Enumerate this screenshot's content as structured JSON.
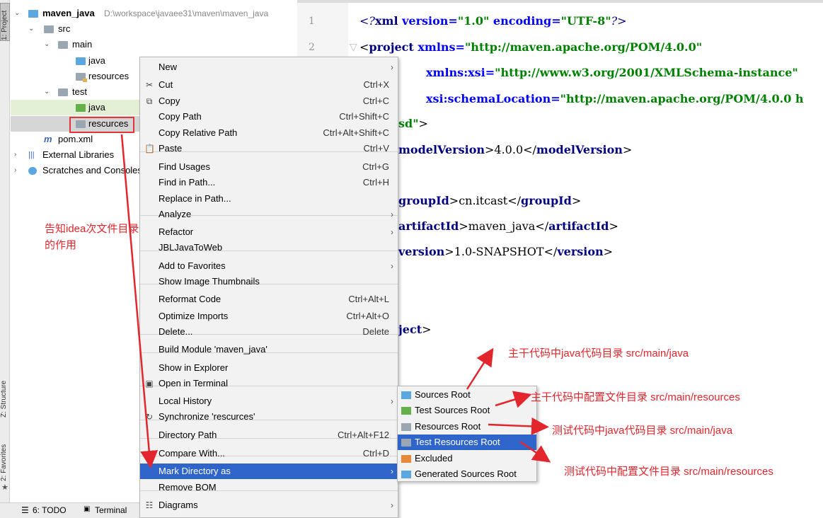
{
  "tool_strip": {
    "project_tab": "1: Project",
    "structure_tab": "Z: Structure",
    "favorites_tab": "2: Favorites"
  },
  "tree": {
    "root_name": "maven_java",
    "root_path": "D:\\workspace\\javaee31\\maven\\maven_java",
    "src": "src",
    "main": "main",
    "main_java": "java",
    "main_resources": "resources",
    "test": "test",
    "test_java": "java",
    "test_resources": "rescurces",
    "pom": "pom.xml",
    "external_libraries": "External Libraries",
    "scratches": "Scratches and Consoles"
  },
  "bottom_bar": {
    "todo": "6: TODO",
    "terminal": "Terminal"
  },
  "editor": {
    "line_numbers": [
      "1",
      "2"
    ],
    "lines": {
      "l1_decl_open": "<?",
      "l1_xml": "xml",
      "l1_version_attr": " version=",
      "l1_version_val": "\"1.0\"",
      "l1_encoding_attr": " encoding=",
      "l1_encoding_val": "\"UTF-8\"",
      "l1_decl_close": "?>",
      "l2_open": "<",
      "l2_tag": "project",
      "l2_attr": " xmlns=",
      "l2_val": "\"http://maven.apache.org/POM/4.0.0\"",
      "l3_attr": "xmlns:xsi=",
      "l3_val": "\"http://www.w3.org/2001/XMLSchema-instance\"",
      "l4_attr": "xsi:schemaLocation=",
      "l4_val": "\"http://maven.apache.org/POM/4.0.0 h",
      "l5_val": "sd\"",
      "l5_close": ">",
      "l6_tag": "modelVersion",
      "l6_text": "4.0.0",
      "l8_tag": "groupId",
      "l8_text": "cn.itcast",
      "l9_tag": "artifactId",
      "l9_text": "maven_java",
      "l10_tag": "version",
      "l10_text": "1.0-SNAPSHOT",
      "l13_tag": "ject"
    }
  },
  "context_menu": {
    "items": [
      {
        "label": "New",
        "shortcut": "",
        "submenu": true
      },
      {
        "label": "Cut",
        "shortcut": "Ctrl+X"
      },
      {
        "label": "Copy",
        "shortcut": "Ctrl+C"
      },
      {
        "label": "Copy Path",
        "shortcut": "Ctrl+Shift+C"
      },
      {
        "label": "Copy Relative Path",
        "shortcut": "Ctrl+Alt+Shift+C"
      },
      {
        "label": "Paste",
        "shortcut": "Ctrl+V"
      },
      {
        "label": "Find Usages",
        "shortcut": "Ctrl+G"
      },
      {
        "label": "Find in Path...",
        "shortcut": "Ctrl+H"
      },
      {
        "label": "Replace in Path...",
        "shortcut": ""
      },
      {
        "label": "Analyze",
        "shortcut": "",
        "submenu": true
      },
      {
        "label": "Refactor",
        "shortcut": "",
        "submenu": true
      },
      {
        "label": "JBLJavaToWeb",
        "shortcut": ""
      },
      {
        "label": "Add to Favorites",
        "shortcut": "",
        "submenu": true
      },
      {
        "label": "Show Image Thumbnails",
        "shortcut": ""
      },
      {
        "label": "Reformat Code",
        "shortcut": "Ctrl+Alt+L"
      },
      {
        "label": "Optimize Imports",
        "shortcut": "Ctrl+Alt+O"
      },
      {
        "label": "Delete...",
        "shortcut": "Delete"
      },
      {
        "label": "Build Module 'maven_java'",
        "shortcut": ""
      },
      {
        "label": "Show in Explorer",
        "shortcut": ""
      },
      {
        "label": "Open in Terminal",
        "shortcut": ""
      },
      {
        "label": "Local History",
        "shortcut": "",
        "submenu": true
      },
      {
        "label": "Synchronize 'rescurces'",
        "shortcut": ""
      },
      {
        "label": "Directory Path",
        "shortcut": "Ctrl+Alt+F12"
      },
      {
        "label": "Compare With...",
        "shortcut": "Ctrl+D"
      },
      {
        "label": "Mark Directory as",
        "shortcut": "",
        "submenu": true,
        "selected": true
      },
      {
        "label": "Remove BOM",
        "shortcut": ""
      },
      {
        "label": "Diagrams",
        "shortcut": "",
        "submenu": true
      }
    ]
  },
  "submenu": {
    "items": [
      {
        "label": "Sources Root",
        "color": "#5da7e0"
      },
      {
        "label": "Test Sources Root",
        "color": "#65b04a"
      },
      {
        "label": "Resources Root",
        "color": "#9aa6b1"
      },
      {
        "label": "Test Resources Root",
        "color": "#9aa6b1",
        "selected": true
      },
      {
        "label": "Excluded",
        "color": "#e8893a"
      },
      {
        "label": "Generated Sources Root",
        "color": "#5da7e0"
      }
    ]
  },
  "annotations": {
    "idea_note_line1": "告知idea次文件目录",
    "idea_note_line2": "的作用",
    "sources_note": "主干代码中java代码目录 src/main/java",
    "resources_note": "主干代码中配置文件目录 src/main/resources",
    "test_sources_note": "测试代码中java代码目录 src/main/java",
    "test_resources_note": "测试代码中配置文件目录 src/main/resources"
  },
  "colors": {
    "annotation_red": "#e3262d",
    "selection_blue": "#2f65ca",
    "xml_tag": "#000080",
    "xml_attr": "#0000ff",
    "xml_string": "#008000"
  }
}
